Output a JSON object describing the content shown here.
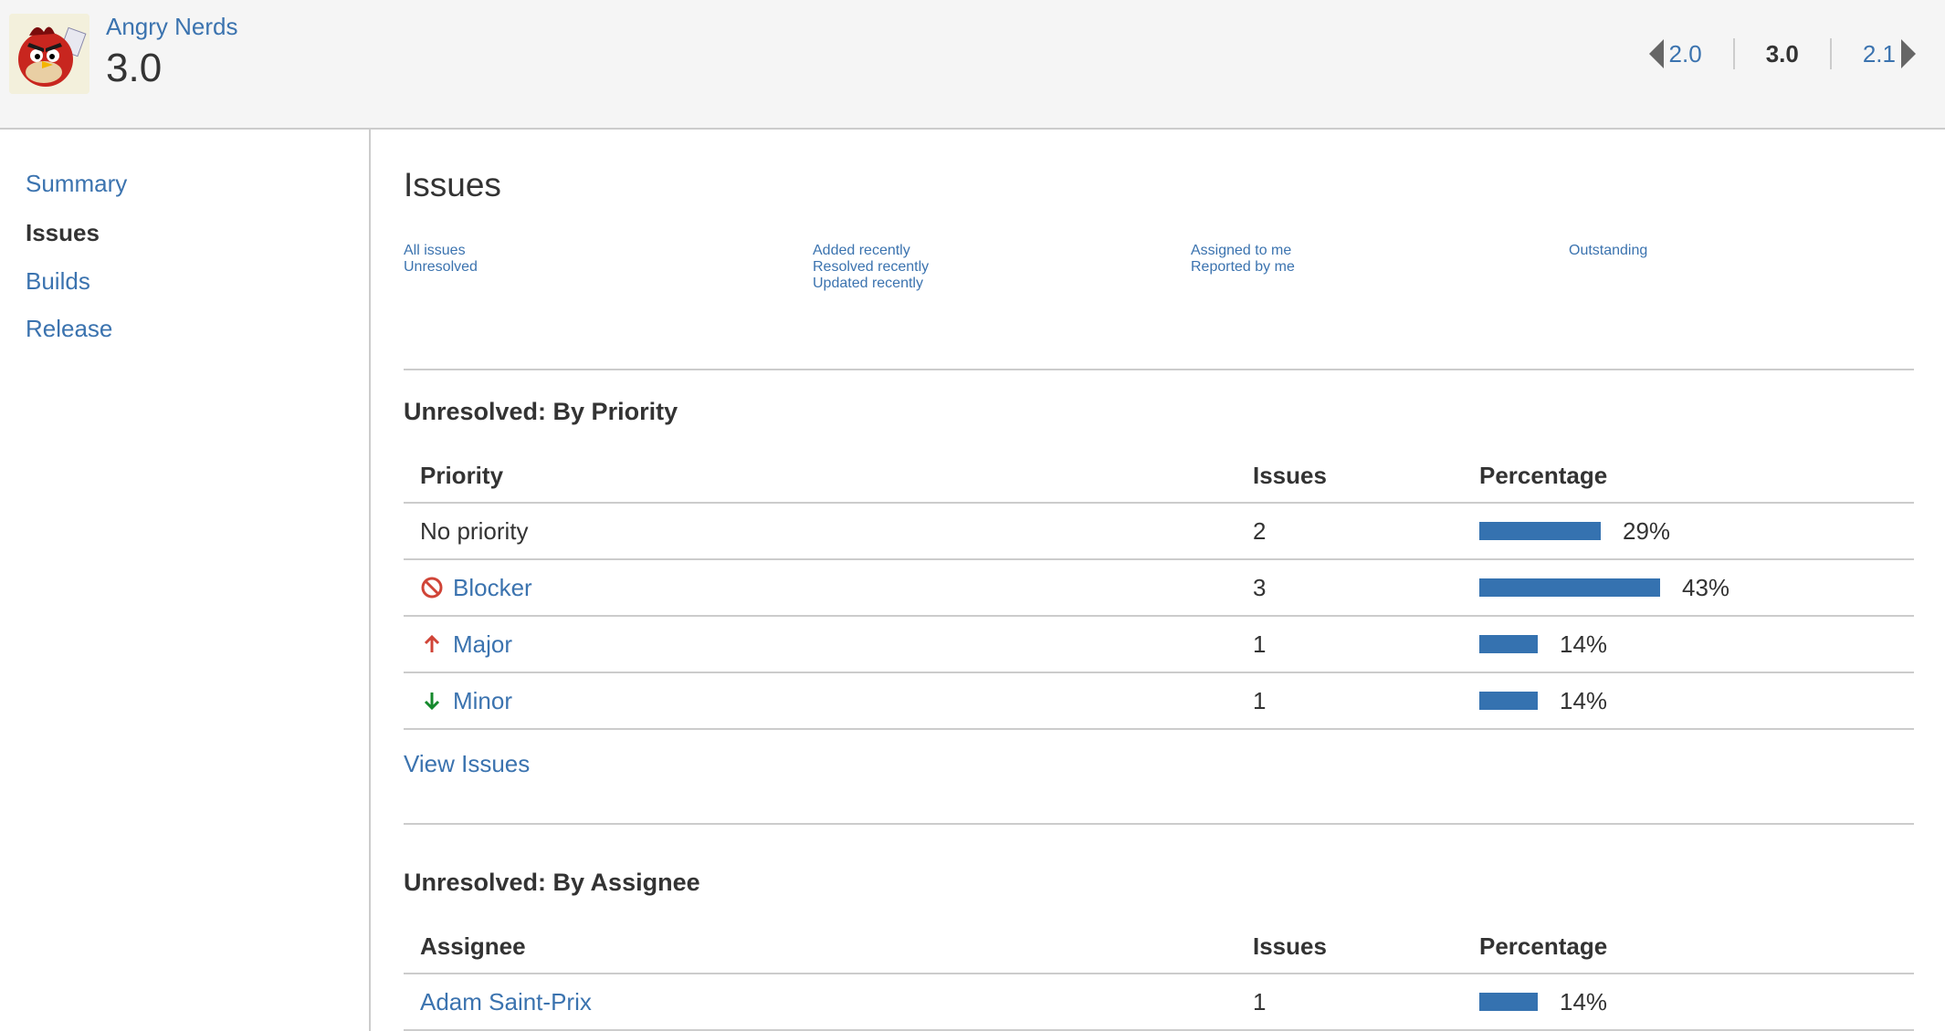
{
  "header": {
    "project_name": "Angry Nerds",
    "version": "3.0",
    "version_nav": {
      "prev": "2.0",
      "current": "3.0",
      "next": "2.1"
    }
  },
  "sidebar": {
    "items": [
      {
        "label": "Summary",
        "active": false
      },
      {
        "label": "Issues",
        "active": true
      },
      {
        "label": "Builds",
        "active": false
      },
      {
        "label": "Release",
        "active": false
      }
    ]
  },
  "main": {
    "title": "Issues",
    "filters": {
      "col1": [
        "All issues",
        "Unresolved"
      ],
      "col2": [
        "Added recently",
        "Resolved recently",
        "Updated recently"
      ],
      "col3": [
        "Assigned to me",
        "Reported by me"
      ],
      "col4": [
        "Outstanding"
      ]
    },
    "by_priority": {
      "title": "Unresolved: By Priority",
      "headers": [
        "Priority",
        "Issues",
        "Percentage"
      ],
      "rows": [
        {
          "name": "No priority",
          "icon": "none",
          "issues": "2",
          "percent": 29,
          "percent_label": "29%"
        },
        {
          "name": "Blocker",
          "icon": "blocker-icon",
          "issues": "3",
          "percent": 43,
          "percent_label": "43%"
        },
        {
          "name": "Major",
          "icon": "major-arrow-up-icon",
          "issues": "1",
          "percent": 14,
          "percent_label": "14%"
        },
        {
          "name": "Minor",
          "icon": "minor-arrow-down-icon",
          "issues": "1",
          "percent": 14,
          "percent_label": "14%"
        }
      ],
      "view_link": "View Issues"
    },
    "by_assignee": {
      "title": "Unresolved: By Assignee",
      "headers": [
        "Assignee",
        "Issues",
        "Percentage"
      ],
      "rows": [
        {
          "name": "Adam Saint-Prix",
          "issues": "1",
          "percent": 14,
          "percent_label": "14%"
        }
      ]
    }
  },
  "colors": {
    "link": "#3b73af",
    "bar": "#3572b0",
    "blocker": "#d04437",
    "major": "#d04437",
    "minor": "#14892c"
  }
}
